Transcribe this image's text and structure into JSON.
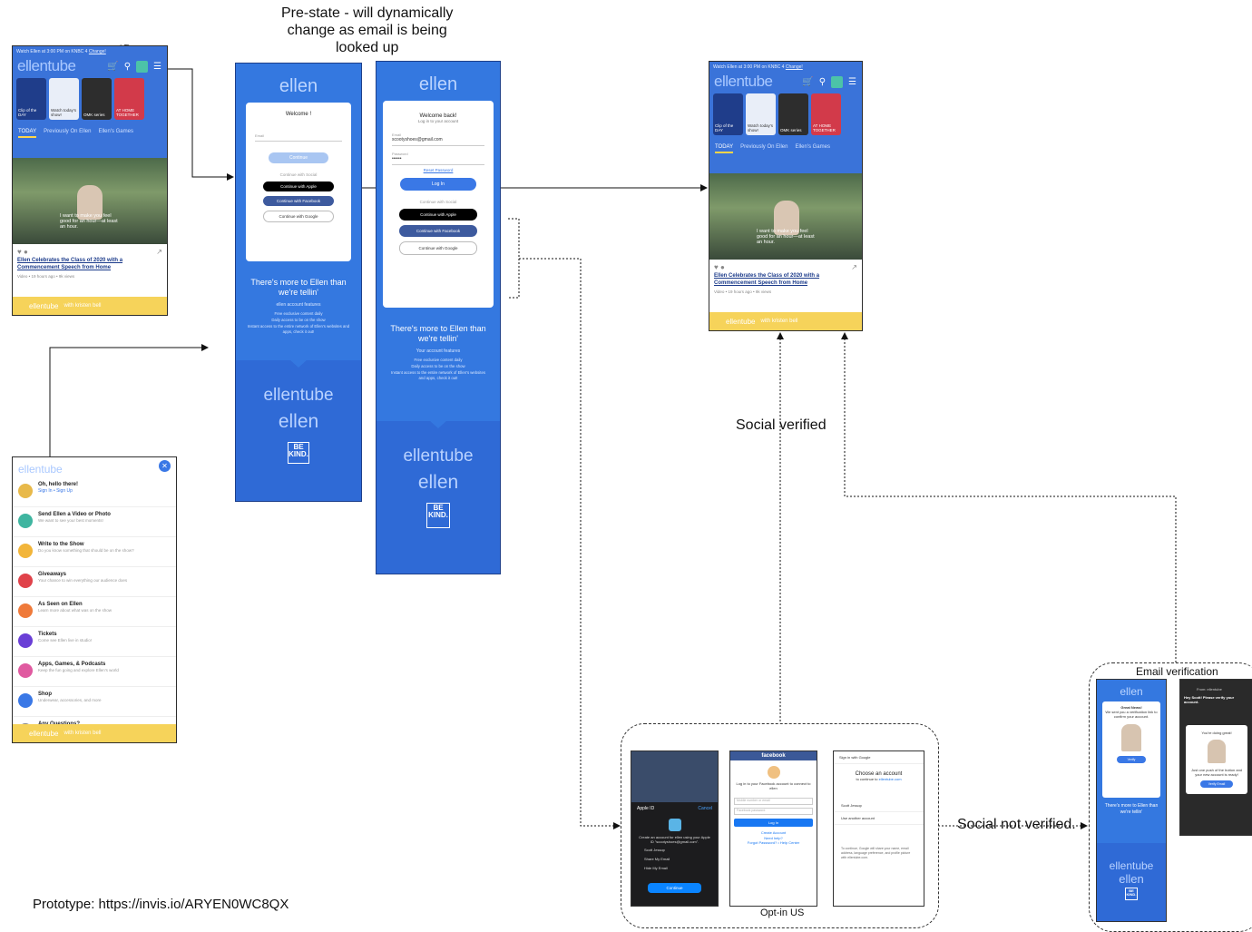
{
  "annotations": {
    "prestate": [
      "Pre-state - will dynamically",
      "change as email is being",
      "looked up"
    ],
    "social_verified": "Social verified",
    "social_not_verified": "Social not verified.",
    "email_verification": "Email verification",
    "opt_in_us": "Opt-in US",
    "prototype": "Prototype:  https://invis.io/ARYEN0WC8QX"
  },
  "home": {
    "topline": "Watch Ellen at 3:00 PM on KNBC 4",
    "change": "Change!",
    "brand": "ellentube",
    "cards": [
      "Clip of the DAY",
      "Watch today's show!",
      "OMK series",
      "AT HOME TOGETHER"
    ],
    "tabs": [
      "TODAY",
      "Previously On Ellen",
      "Ellen's Games"
    ],
    "caption": "I want to make you feel good for an hour—at least an hour.",
    "title": "Ellen Celebrates the Class of 2020 with a Commencement Speech from Home",
    "meta": "Video • 19 hours ago • 9k views",
    "ad": "with kristen bell"
  },
  "menu": {
    "brand": "ellentube",
    "items": [
      {
        "title": "Oh, hello there!",
        "desc": "Sign In • Sign Up",
        "color": "#e8b94a"
      },
      {
        "title": "Send Ellen a Video or Photo",
        "desc": "We want to see your best moments!",
        "color": "#3fb5a0"
      },
      {
        "title": "Write to the Show",
        "desc": "Do you know something that should be on the show?",
        "color": "#f2b53a"
      },
      {
        "title": "Giveaways",
        "desc": "Your chance to win everything our audience does",
        "color": "#e0424a"
      },
      {
        "title": "As Seen on Ellen",
        "desc": "Learn more about what was on the show",
        "color": "#ef7a3a"
      },
      {
        "title": "Tickets",
        "desc": "Come see Ellen live in studio!",
        "color": "#6a3fd6"
      },
      {
        "title": "Apps, Games, & Podcasts",
        "desc": "Keep the fun going and explore Ellen's world",
        "color": "#e05aa0"
      },
      {
        "title": "Shop",
        "desc": "Underwear, accessories, and more",
        "color": "#3a78e6"
      },
      {
        "title": "Any Questions?",
        "desc": "",
        "color": "#888888"
      }
    ]
  },
  "login1": {
    "logo": "ellen",
    "heading": "Welcome !",
    "email_label": "Email",
    "continue": "Continue",
    "social_heading": "Continue with Social",
    "apple": "Continue with Apple",
    "facebook": "Continue with Facebook",
    "google": "Continue with Google",
    "promo_title": "There's more to Ellen than we're tellin'",
    "promo_features": "ellen account features",
    "promo_lines": [
      "Free exclusive content daily",
      "Daily access to be on the show",
      "Instant access to the entire network of Ellen's websites and apps, check it out!"
    ],
    "et": "ellentube",
    "el": "ellen",
    "bk": "BE KIND."
  },
  "login2": {
    "logo": "ellen",
    "heading": "Welcome back!",
    "sub": "Log in to your account",
    "email_label": "Email",
    "email_value": "scootyshoes@gmail.com",
    "password_label": "Password",
    "password_value": "••••••",
    "reset": "Reset Password",
    "login": "Log In",
    "social_heading": "Continue with Social",
    "apple": "Continue with Apple",
    "facebook": "Continue with Facebook",
    "google": "Continue with Google",
    "promo_title": "There's more to Ellen than we're tellin'",
    "promo_features": "Your account features",
    "promo_lines": [
      "Free exclusive content daily",
      "Daily access to be on the show",
      "Instant access to the entire network of Ellen's websites and apps, check it out!"
    ],
    "et": "ellentube",
    "el": "ellen",
    "bk": "BE KIND."
  },
  "apple": {
    "title": "Apple ID",
    "cancel": "Cancel",
    "text": "Create an account for ellen using your Apple ID \"scootyshoes@gmail.com\".",
    "name": "Scott Jessop",
    "share": "Share My Email",
    "hide": "Hide My Email",
    "continue": "Continue"
  },
  "facebook": {
    "bar": "facebook",
    "text": "Log in to your Facebook account to connect to ellen",
    "email_ph": "Mobile number or email",
    "pass_ph": "Facebook password",
    "login": "Log In",
    "create": "Create Account",
    "help": "Need help?",
    "forgot": "Forgot Password? • Help Center"
  },
  "google": {
    "header": "Sign in with Google",
    "title": "Choose an account",
    "sub_prefix": "to continue to",
    "sub_site": "ellentube.com",
    "account": "Scott Jessop",
    "other": "Use another account",
    "foot": "To continue, Google will share your name, email address, language preference, and profile picture with ellentube.com."
  },
  "email_verif": {
    "greeting": "Great News!",
    "line": "We sent you a verification link to confirm your account.",
    "btn": "Verify",
    "promo": "There's more to Ellen than we're tellin'",
    "et": "ellentube",
    "el": "ellen",
    "mail_from": "From: ellentube",
    "mail_subject": "Hey Scott! Please verify your account.",
    "card_t": "You're doing great!",
    "card_d": "Just one push of the button and your new account is ready!",
    "card_btn": "Verify Email"
  }
}
